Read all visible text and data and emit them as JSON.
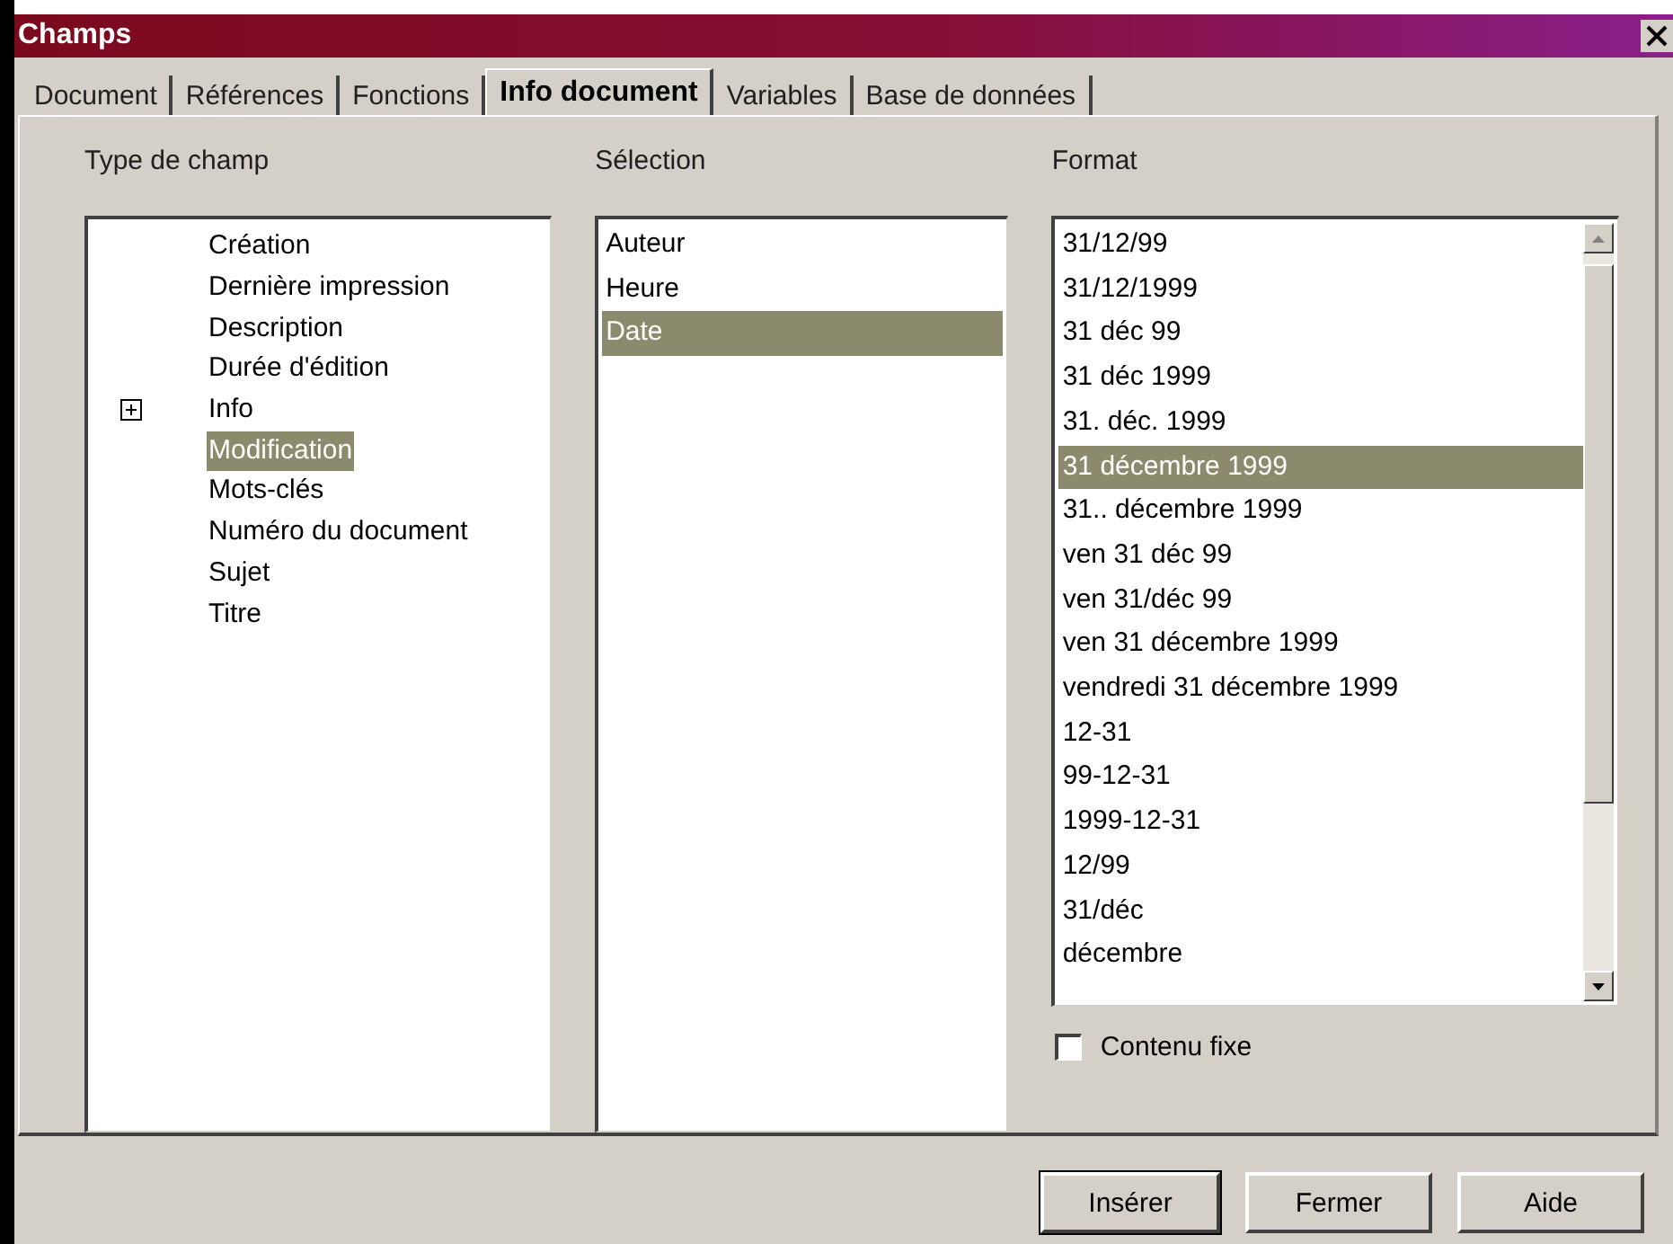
{
  "window": {
    "title": "Champs"
  },
  "tabs": [
    {
      "label": "Document",
      "selected": false
    },
    {
      "label": "Références",
      "selected": false
    },
    {
      "label": "Fonctions",
      "selected": false
    },
    {
      "label": "Info document",
      "selected": true
    },
    {
      "label": "Variables",
      "selected": false
    },
    {
      "label": "Base de données",
      "selected": false
    }
  ],
  "type_de_champ": {
    "label": "Type de champ",
    "items": [
      {
        "label": "Création",
        "selected": false
      },
      {
        "label": "Dernière impression",
        "selected": false
      },
      {
        "label": "Description",
        "selected": false
      },
      {
        "label": "Durée d'édition",
        "selected": false
      },
      {
        "label": "Info",
        "selected": false,
        "expanded": false
      },
      {
        "label": "Modification",
        "selected": true
      },
      {
        "label": "Mots-clés",
        "selected": false
      },
      {
        "label": "Numéro du document",
        "selected": false
      },
      {
        "label": "Sujet",
        "selected": false
      },
      {
        "label": "Titre",
        "selected": false
      }
    ]
  },
  "selection": {
    "label": "Sélection",
    "items": [
      {
        "label": "Auteur",
        "selected": false
      },
      {
        "label": "Heure",
        "selected": false
      },
      {
        "label": "Date",
        "selected": true
      }
    ]
  },
  "format": {
    "label": "Format",
    "items": [
      {
        "label": "31/12/99",
        "selected": false
      },
      {
        "label": "31/12/1999",
        "selected": false
      },
      {
        "label": "31 déc 99",
        "selected": false
      },
      {
        "label": "31 déc 1999",
        "selected": false
      },
      {
        "label": "31. déc. 1999",
        "selected": false
      },
      {
        "label": "31 décembre 1999",
        "selected": true
      },
      {
        "label": "31.. décembre 1999",
        "selected": false
      },
      {
        "label": "ven 31 déc 99",
        "selected": false
      },
      {
        "label": "ven 31/déc 99",
        "selected": false
      },
      {
        "label": "ven 31 décembre 1999",
        "selected": false
      },
      {
        "label": "vendredi 31 décembre 1999",
        "selected": false
      },
      {
        "label": "12-31",
        "selected": false
      },
      {
        "label": "99-12-31",
        "selected": false
      },
      {
        "label": "1999-12-31",
        "selected": false
      },
      {
        "label": "12/99",
        "selected": false
      },
      {
        "label": "31/déc",
        "selected": false
      },
      {
        "label": "décembre",
        "selected": false
      }
    ]
  },
  "contenu_fixe": {
    "label": "Contenu fixe",
    "checked": false
  },
  "buttons": [
    {
      "label": "Insérer",
      "default": true
    },
    {
      "label": "Fermer",
      "default": false
    },
    {
      "label": "Aide",
      "default": false
    }
  ]
}
